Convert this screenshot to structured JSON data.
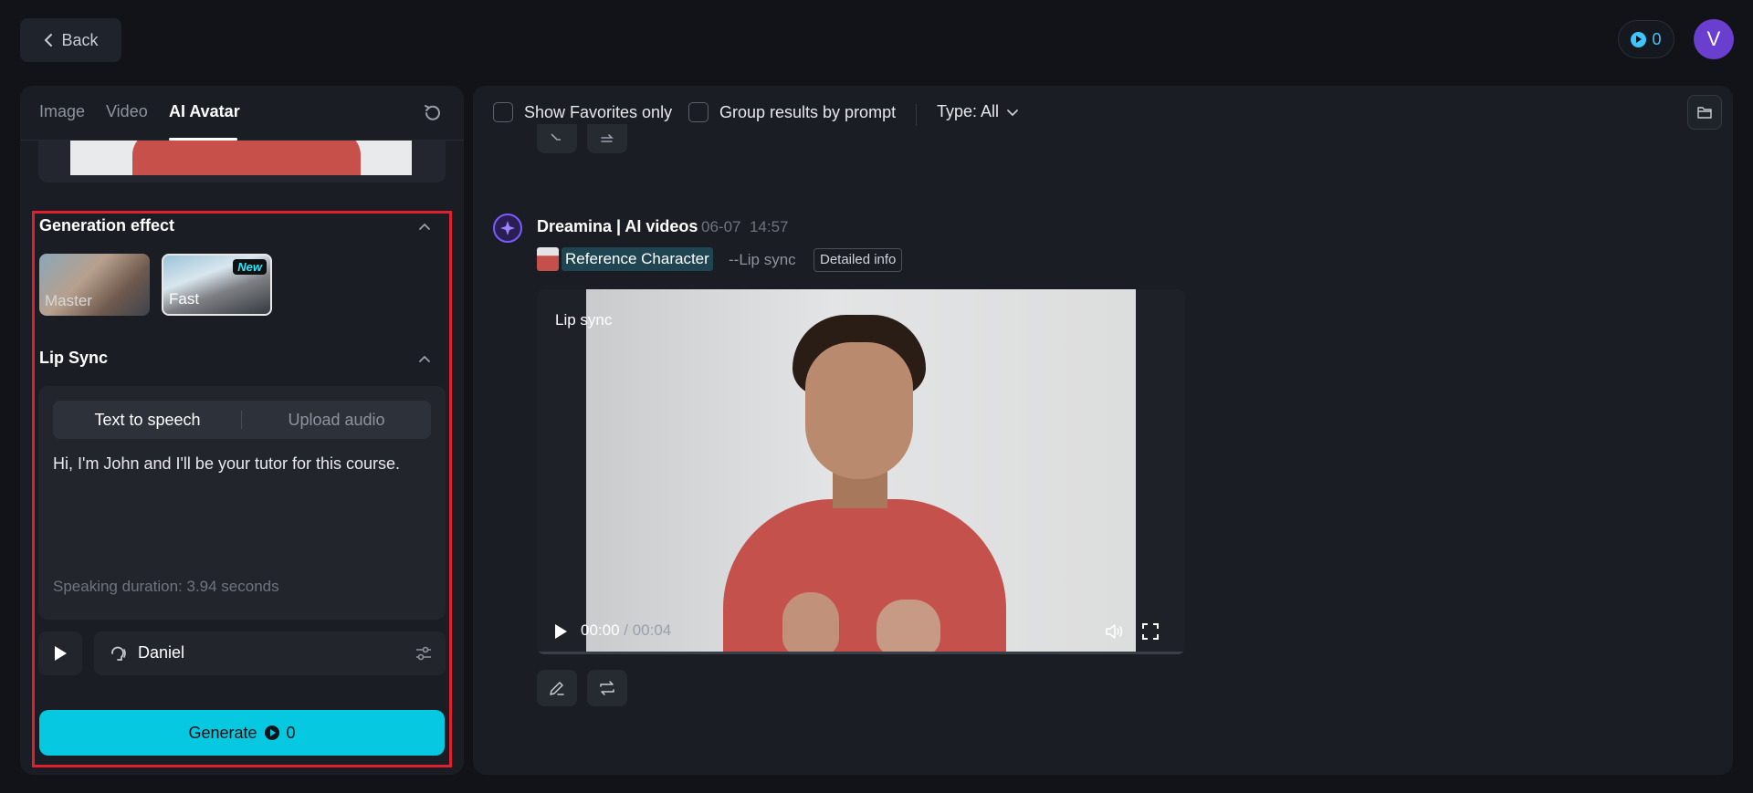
{
  "header": {
    "back_label": "Back",
    "credits": "0",
    "avatar_letter": "V"
  },
  "left_panel": {
    "tabs": [
      {
        "label": "Image"
      },
      {
        "label": "Video"
      },
      {
        "label": "AI Avatar",
        "active": true
      }
    ],
    "generation_effect": {
      "title": "Generation effect",
      "options": [
        {
          "label": "Master"
        },
        {
          "label": "Fast",
          "badge": "New",
          "selected": true
        }
      ]
    },
    "lip_sync": {
      "title": "Lip Sync",
      "modes": [
        {
          "label": "Text to speech",
          "active": true
        },
        {
          "label": "Upload audio"
        }
      ],
      "text": "Hi, I'm John and I'll be your tutor for this course.",
      "duration": "Speaking duration: 3.94 seconds",
      "voice": "Daniel"
    },
    "generate": {
      "label": "Generate",
      "cost": "0"
    }
  },
  "right_panel": {
    "toolbar": {
      "favorites_label": "Show Favorites only",
      "group_label": "Group results by prompt",
      "type_label": "Type: All"
    },
    "message": {
      "title": "Dreamina | AI videos",
      "date": "06-07",
      "time": "14:57",
      "ref_label": "Reference Character",
      "mode_tag": "--Lip sync",
      "detail_label": "Detailed info",
      "video": {
        "label": "Lip sync",
        "current": "00:00",
        "separator": " / ",
        "duration": "00:04"
      }
    }
  },
  "colors": {
    "accent": "#06c8e0",
    "highlight": "#e0202c",
    "avatar": "#6a3fd0",
    "credits": "#3ec5ff"
  }
}
